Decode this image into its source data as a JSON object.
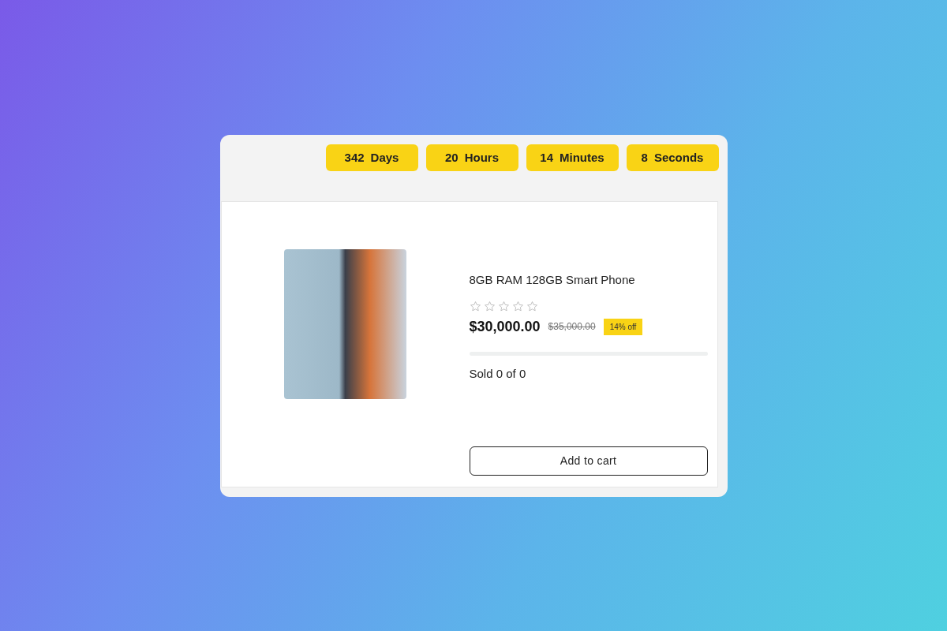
{
  "countdown": [
    {
      "value": "342",
      "unit": "Days"
    },
    {
      "value": "20",
      "unit": "Hours"
    },
    {
      "value": "14",
      "unit": "Minutes"
    },
    {
      "value": "8",
      "unit": "Seconds"
    }
  ],
  "product": {
    "title": "8GB RAM 128GB Smart Phone",
    "stars": 0,
    "price": "$30,000.00",
    "old_price": "$35,000.00",
    "discount": "14% off",
    "sold": {
      "level": 0,
      "text": "Sold 0 of 0"
    },
    "button": "Add to cart"
  }
}
